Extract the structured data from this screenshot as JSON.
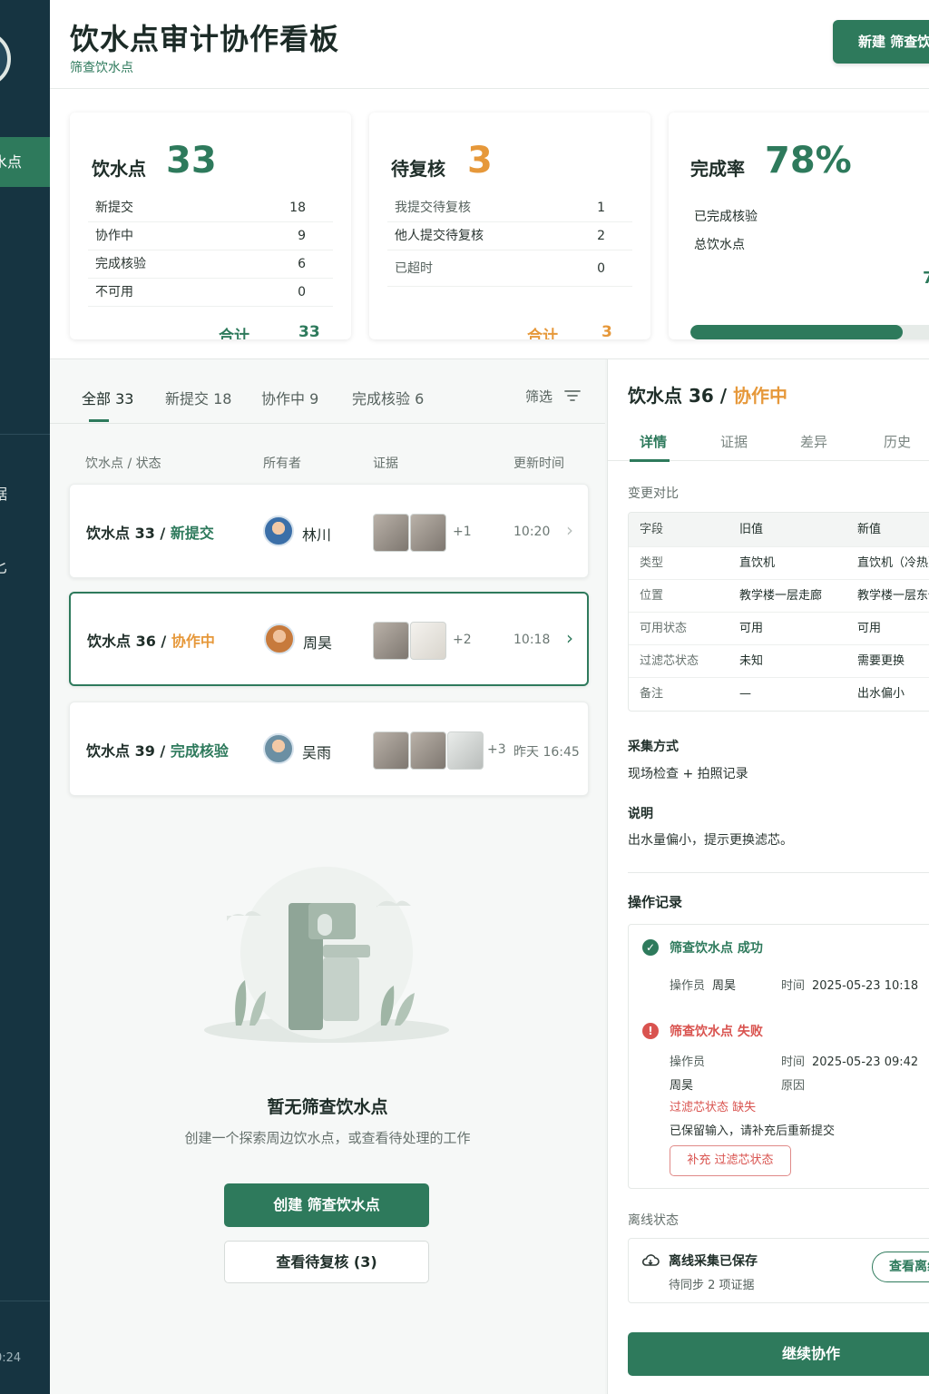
{
  "sidebar": {
    "active_label": "水点",
    "item_1_label": "据",
    "item_2_label": "匕",
    "time": "0:24"
  },
  "header": {
    "title": "饮水点审计协作看板",
    "subtitle": "筛查饮水点",
    "new_button": "新建 筛查饮水点"
  },
  "stats": {
    "card1": {
      "title": "饮水点",
      "value": "33",
      "rows": [
        {
          "label": "新提交",
          "value": "18"
        },
        {
          "label": "协作中",
          "value": "9"
        },
        {
          "label": "完成核验",
          "value": "6"
        },
        {
          "label": "不可用",
          "value": "0"
        }
      ],
      "sum_label": "合计",
      "sum_value": "33"
    },
    "card2": {
      "title": "待复核",
      "value": "3",
      "rows": [
        {
          "label": "我提交待复核",
          "value": "1"
        },
        {
          "label": "他人提交待复核",
          "value": "2"
        },
        {
          "label": "已超时",
          "value": "0"
        }
      ],
      "sum_label": "合计",
      "sum_value": "3"
    },
    "card3": {
      "title": "完成率",
      "value": "78%",
      "rows": [
        {
          "label": "已完成核验",
          "value": ""
        },
        {
          "label": "总饮水点",
          "value": ""
        }
      ],
      "extra": "7",
      "progress": 0.78
    }
  },
  "list": {
    "tabs": [
      "全部 33",
      "新提交 18",
      "协作中 9",
      "完成核验 6"
    ],
    "filter": "筛选",
    "columns": [
      "饮水点 / 状态",
      "所有者",
      "证据",
      "更新时间"
    ],
    "items": [
      {
        "name": "饮水点 33 / ",
        "status": "新提交",
        "owner": "林川",
        "more": "+1",
        "time": "10:20"
      },
      {
        "name": "饮水点 36 / ",
        "status": "协作中",
        "owner": "周昊",
        "more": "+2",
        "time": "10:18"
      },
      {
        "name": "饮水点 39 / ",
        "status": "完成核验",
        "owner": "吴雨",
        "more": "+3",
        "time": "昨天 16:45"
      }
    ],
    "empty_title": "暂无筛查饮水点",
    "empty_desc": "创建一个探索周边饮水点，或查看待处理的工作",
    "create_button": "创建 筛查饮水点",
    "review_button": "查看待复核 (3)"
  },
  "detail": {
    "title": "饮水点 36 / ",
    "status": "协作中",
    "tabs": [
      "详情",
      "证据",
      "差异",
      "历史"
    ],
    "compare_label": "变更对比",
    "compare_head": [
      "字段",
      "旧值",
      "新值"
    ],
    "compare_rows": [
      [
        "类型",
        "直饮机",
        "直饮机（冷热）"
      ],
      [
        "位置",
        "教学楼一层走廊",
        "教学楼一层东侧"
      ],
      [
        "可用状态",
        "可用",
        "可用"
      ],
      [
        "过滤芯状态",
        "未知",
        "需要更换"
      ],
      [
        "备注",
        "—",
        "出水偏小"
      ]
    ],
    "method_label": "采集方式",
    "method_value": "现场检查 + 拍照记录",
    "note_label": "说明",
    "note_value": "出水量偏小，提示更换滤芯。",
    "log_label": "操作记录",
    "log_success": {
      "title": "筛查饮水点 成功",
      "operator_label": "操作员",
      "operator": "周昊",
      "time_label": "时间",
      "time": "2025-05-23 10:18"
    },
    "log_fail": {
      "title": "筛查饮水点 失败",
      "operator_label": "操作员",
      "operator": "周昊",
      "time_label": "时间",
      "time": "2025-05-23 09:42",
      "reason_label": "原因",
      "error": "过滤芯状态 缺失",
      "hint": "已保留输入，请补充后重新提交",
      "retry_button": "补充 过滤芯状态"
    },
    "offline_label": "离线状态",
    "offline_title": "离线采集已保存",
    "offline_desc": "待同步 2 项证据",
    "offline_button": "查看离线",
    "continue_button": "继续协作"
  },
  "colors": {
    "brand": "#2e7a5c",
    "sidebar": "#163441",
    "warning": "#e6983a",
    "error": "#d9534f"
  }
}
